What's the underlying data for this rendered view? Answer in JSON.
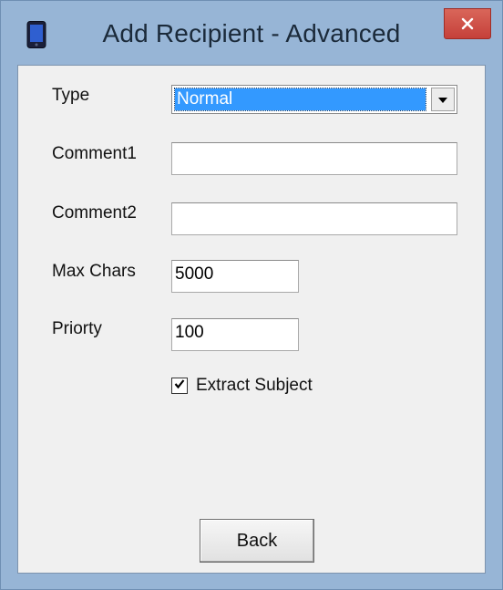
{
  "window": {
    "title": "Add Recipient - Advanced"
  },
  "icons": {
    "app": "phone-icon",
    "close": "close-icon",
    "dropdown": "chevron-down-icon",
    "check": "checkmark-icon"
  },
  "colors": {
    "title_bar": "#97b5d6",
    "close_button": "#c9473f",
    "selection": "#3399ff",
    "dialog_background": "#f0f0f0"
  },
  "form": {
    "type": {
      "label": "Type",
      "value": "Normal"
    },
    "comment1": {
      "label": "Comment1",
      "value": ""
    },
    "comment2": {
      "label": "Comment2",
      "value": ""
    },
    "max_chars": {
      "label": "Max Chars",
      "value": "5000"
    },
    "priority": {
      "label": "Priorty",
      "value": "100"
    },
    "extract_subject": {
      "label": "Extract Subject",
      "checked": true
    }
  },
  "buttons": {
    "back": "Back"
  }
}
